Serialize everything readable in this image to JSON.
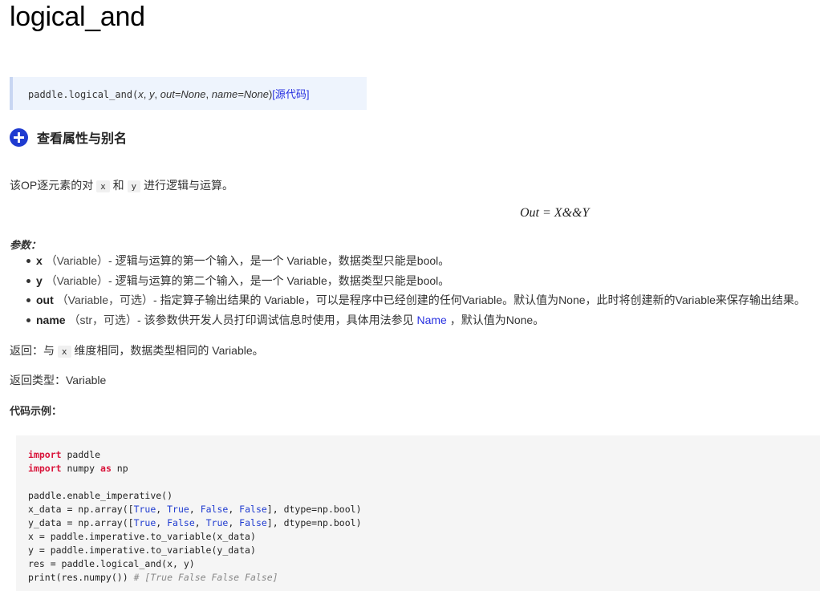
{
  "page": {
    "title": "logical_and"
  },
  "signature": {
    "prefix": "paddle.logical_and(",
    "arg_x": "x",
    "sep1": ", ",
    "arg_y": "y",
    "sep2": ", ",
    "arg_out": "out=None",
    "sep3": ", ",
    "arg_name": "name=None",
    "suffix": ")",
    "source_link": "[源代码]"
  },
  "toggle": {
    "label": "查看属性与别名",
    "icon": "plus-circle-icon"
  },
  "description": {
    "part1": "该OP逐元素的对 ",
    "code_x": "x",
    "part2": " 和 ",
    "code_y": "y",
    "part3": " 进行逻辑与运算。"
  },
  "formula": "Out = X&&Y",
  "params": {
    "label": "参数：",
    "items": [
      {
        "name": "x",
        "type": "（Variable）",
        "desc": "- 逻辑与运算的第一个输入，是一个 Variable，数据类型只能是bool。"
      },
      {
        "name": "y",
        "type": "（Variable）",
        "desc": "- 逻辑与运算的第二个输入，是一个 Variable，数据类型只能是bool。"
      },
      {
        "name": "out",
        "type": "（Variable，可选）",
        "desc": "- 指定算子输出结果的 Variable，可以是程序中已经创建的任何Variable。默认值为None，此时将创建新的Variable来保存输出结果。"
      },
      {
        "name": "name",
        "type": "（str，可选）",
        "desc": "- 该参数供开发人员打印调试信息时使用，具体用法参见 ",
        "link": "Name",
        "desc_after": " ，默认值为None。"
      }
    ]
  },
  "returns": {
    "part1": "返回：与 ",
    "code_x": "x",
    "part2": " 维度相同，数据类型相同的 Variable。"
  },
  "return_type": "返回类型：Variable",
  "example_label": "代码示例：",
  "code": {
    "kw_import": "import",
    "kw_as": "as",
    "mod_paddle": " paddle",
    "mod_numpy": " numpy ",
    "alias_np": " np",
    "line3": "paddle.enable_imperative()",
    "xdata_prefix": "x_data = np.array([",
    "ydata_prefix": "y_data = np.array([",
    "c_true": "True",
    "c_false": "False",
    "comma": ", ",
    "array_suffix": "], dtype=np.bool)",
    "line6": "x = paddle.imperative.to_variable(x_data)",
    "line7": "y = paddle.imperative.to_variable(y_data)",
    "line8": "res = paddle.logical_and(x, y)",
    "line9_code": "print(res.numpy()) ",
    "line9_comment": "# [True False False False]"
  }
}
